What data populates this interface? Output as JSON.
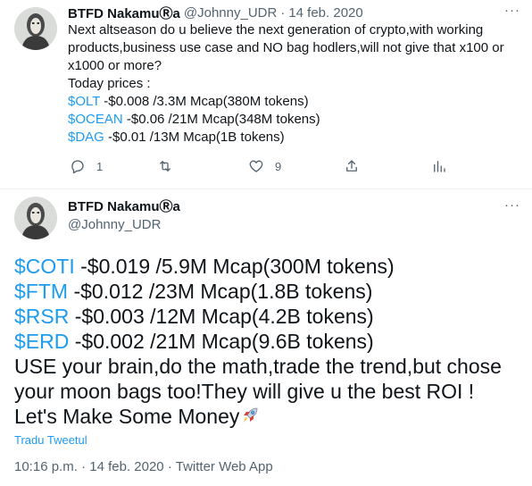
{
  "colors": {
    "link": "#1d9bf0",
    "text": "#0f1419",
    "muted": "#536471"
  },
  "tweet1": {
    "display_name": "BTFD NakamuⓇa",
    "handle": "@Johnny_UDR",
    "separator": "·",
    "date": "14 feb. 2020",
    "more_glyph": "···",
    "intro_line1": "Next altseason do u believe the next generation of crypto,with working",
    "intro_line2": "products,business use case and NO bag hodlers,will not give that x100 or",
    "intro_line3": "x1000 or more?",
    "prices_label": "Today prices :",
    "prices": [
      {
        "ticker": "$OLT",
        "details": " -$0.008 /3.3M Mcap(380M tokens)"
      },
      {
        "ticker": "$OCEAN",
        "details": " -$0.06 /21M Mcap(348M tokens)"
      },
      {
        "ticker": "$DAG",
        "details": " -$0.01 /13M Mcap(1B tokens)"
      }
    ],
    "actions": {
      "reply_icon": "reply-icon",
      "reply_count": "1",
      "retweet_icon": "retweet-icon",
      "like_icon": "heart-icon",
      "like_count": "9",
      "share_icon": "share-icon",
      "analytics_icon": "analytics-icon"
    }
  },
  "tweet2": {
    "display_name": "BTFD NakamuⓇa",
    "handle": "@Johnny_UDR",
    "more_glyph": "···",
    "prices": [
      {
        "ticker": "$COTI",
        "details": " -$0.019 /5.9M Mcap(300M tokens)"
      },
      {
        "ticker": "$FTM",
        "details": " -$0.012 /23M Mcap(1.8B tokens)"
      },
      {
        "ticker": "$RSR",
        "details": " -$0.003 /12M Mcap(4.2B tokens)"
      },
      {
        "ticker": "$ERD",
        "details": " -$0.002 /21M Mcap(9.6B tokens)"
      }
    ],
    "closing_line1": "USE your brain,do the math,trade the trend,but chose",
    "closing_line2": "your moon bags too!They will give u the best ROI !",
    "closing_line3": "Let's Make Some Money",
    "emoji": "rocket-icon",
    "translate_label": "Tradu Tweetul",
    "time": "10:16 p.m.",
    "date": "14 feb. 2020",
    "meta_separator": "·",
    "client": "Twitter Web App"
  }
}
